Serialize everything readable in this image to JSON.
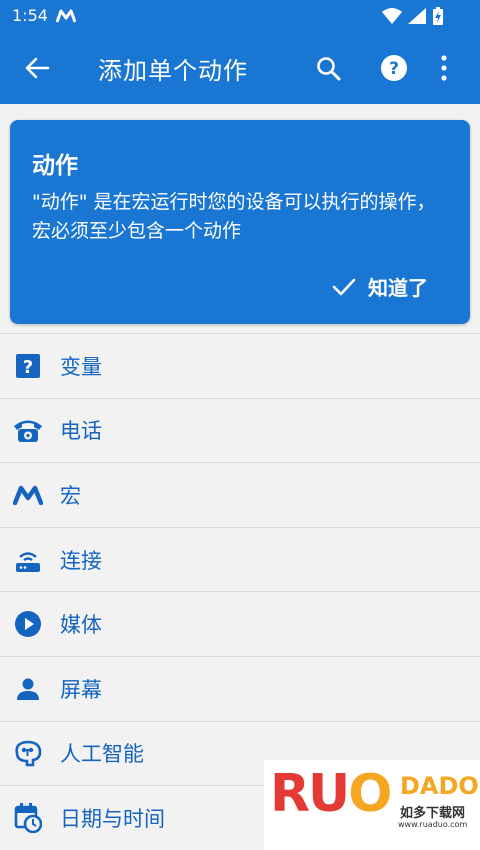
{
  "status_bar": {
    "time": "1:54",
    "icons": [
      "macrodroid-m-icon",
      "wifi-icon",
      "signal-icon",
      "battery-charging-icon"
    ]
  },
  "app_bar": {
    "title": "添加单个动作",
    "icons": [
      "back-arrow-icon",
      "search-icon",
      "help-icon",
      "more-vert-icon"
    ]
  },
  "info_card": {
    "title": "动作",
    "body": "\"动作\" 是在宏运行时您的设备可以执行的操作，宏必须至少包含一个动作",
    "confirm_label": "知道了"
  },
  "categories": [
    {
      "label": "变量",
      "icon": "question-box-icon"
    },
    {
      "label": "电话",
      "icon": "telephone-icon"
    },
    {
      "label": "宏",
      "icon": "macro-m-icon"
    },
    {
      "label": "连接",
      "icon": "router-icon"
    },
    {
      "label": "媒体",
      "icon": "play-circle-icon"
    },
    {
      "label": "屏幕",
      "icon": "person-icon"
    },
    {
      "label": "人工智能",
      "icon": "ai-brain-icon"
    },
    {
      "label": "日期与时间",
      "icon": "calendar-clock-icon"
    }
  ],
  "watermark": {
    "brand": "RUO",
    "brand_suffix": "DADO",
    "cn": "如多下载网",
    "url": "www.ruaduo.com"
  },
  "colors": {
    "primary": "#1976d2",
    "list_text": "#1565c0",
    "background": "#f2f2f2"
  }
}
